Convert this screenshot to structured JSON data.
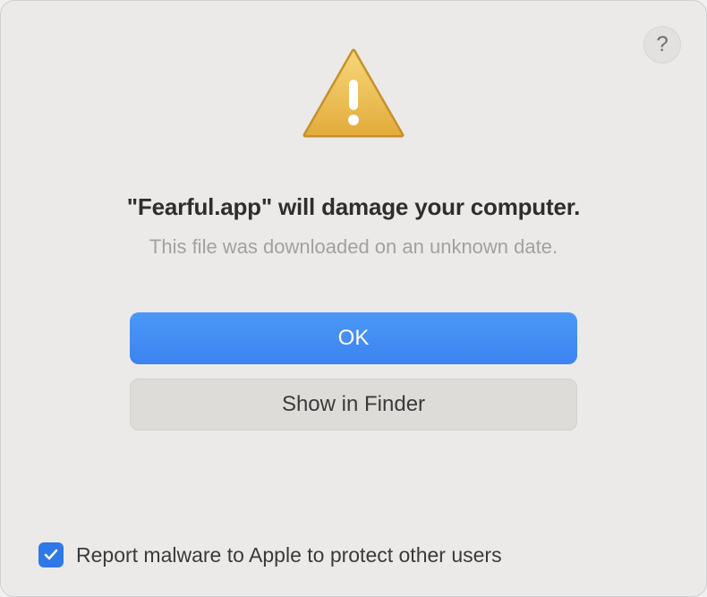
{
  "dialog": {
    "help_label": "?",
    "title": "\"Fearful.app\" will damage your computer.",
    "subtitle": "This file was downloaded on an unknown date.",
    "ok_label": "OK",
    "show_in_finder_label": "Show in Finder",
    "checkbox_label": "Report malware to Apple to protect other users",
    "checkbox_checked": true
  },
  "colors": {
    "primary_button": "#3c83f0",
    "secondary_button": "#dedcd9",
    "checkbox": "#2f78e7",
    "warning_fill": "#e8b63f",
    "warning_stroke": "#c6902a"
  }
}
